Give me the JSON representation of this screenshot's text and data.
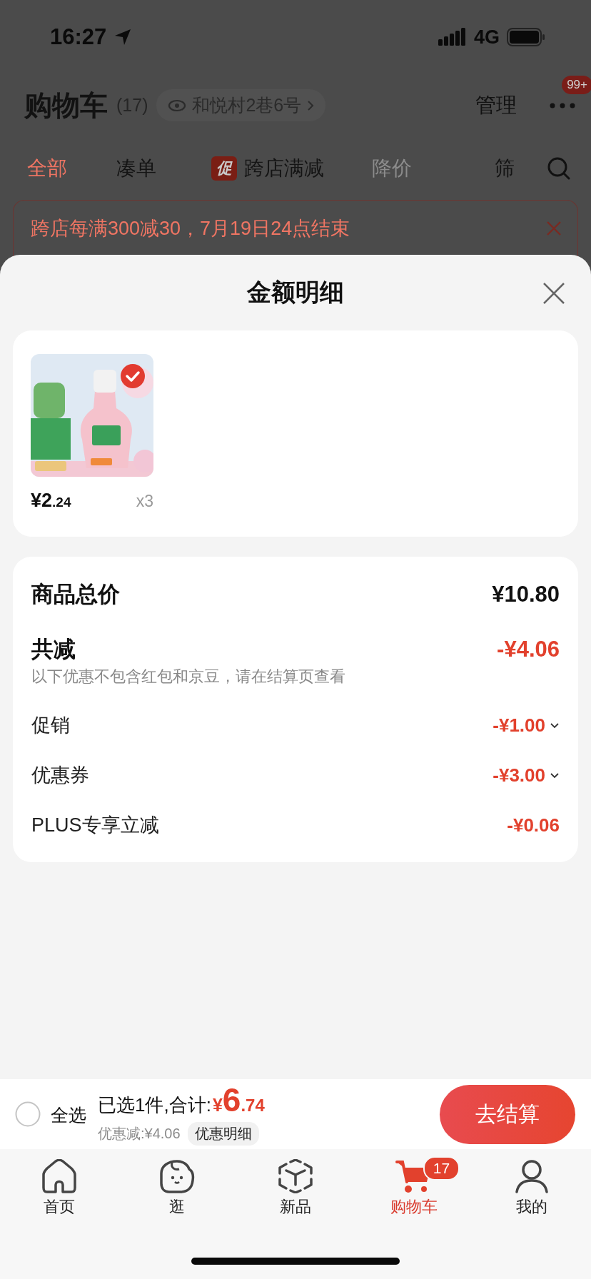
{
  "status_bar": {
    "time": "16:27",
    "network": "4G"
  },
  "header": {
    "title": "购物车",
    "count": "(17)",
    "address": "和悦村2巷6号",
    "manage": "管理",
    "more_badge": "99+"
  },
  "filter_tabs": [
    {
      "label": "全部",
      "selected": true,
      "disabled": false
    },
    {
      "label": "凑单",
      "selected": false,
      "disabled": false
    },
    {
      "label": "跨店满减",
      "badge": "促",
      "selected": false,
      "disabled": false
    },
    {
      "label": "降价",
      "selected": false,
      "disabled": true
    },
    {
      "label": "筛",
      "selected": false,
      "disabled": false
    }
  ],
  "promo_banner": {
    "text": "跨店每满300减30，7月19日24点结束"
  },
  "sheet": {
    "title": "金额明细",
    "products": [
      {
        "kind": "picture",
        "price_main": "¥2",
        "price_decimal": ".24",
        "quantity": "x3",
        "checked": true
      }
    ],
    "summary": {
      "total_label": "商品总价",
      "total_value": "¥10.80",
      "discount_label": "共减",
      "discount_value": "-¥4.06",
      "note": "以下优惠不包含红包和京豆，请在结算页查看"
    },
    "breakdown": [
      {
        "label": "促销",
        "value": "-¥1.00",
        "expandable": true
      },
      {
        "label": "优惠券",
        "value": "-¥3.00",
        "expandable": true
      },
      {
        "label": "PLUS专享立减",
        "value": "-¥0.06",
        "expandable": false
      }
    ]
  },
  "checkout_bar": {
    "select_all": {
      "label": "全选",
      "checked": false
    },
    "selected_text": "已选1件,合计:",
    "currency": "¥",
    "total_main": "6",
    "total_decimal": ".74",
    "discount_text": "优惠减:¥4.06",
    "detail_button": "优惠明细",
    "checkout_button": "去结算"
  },
  "tab_bar": [
    {
      "label": "首页",
      "kind": "home",
      "selected": false
    },
    {
      "label": "逛",
      "kind": "face",
      "selected": false
    },
    {
      "label": "新品",
      "kind": "cube",
      "selected": false
    },
    {
      "label": "购物车",
      "kind": "cart",
      "selected": true,
      "badge": "17"
    },
    {
      "label": "我的",
      "kind": "person",
      "selected": false
    }
  ]
}
